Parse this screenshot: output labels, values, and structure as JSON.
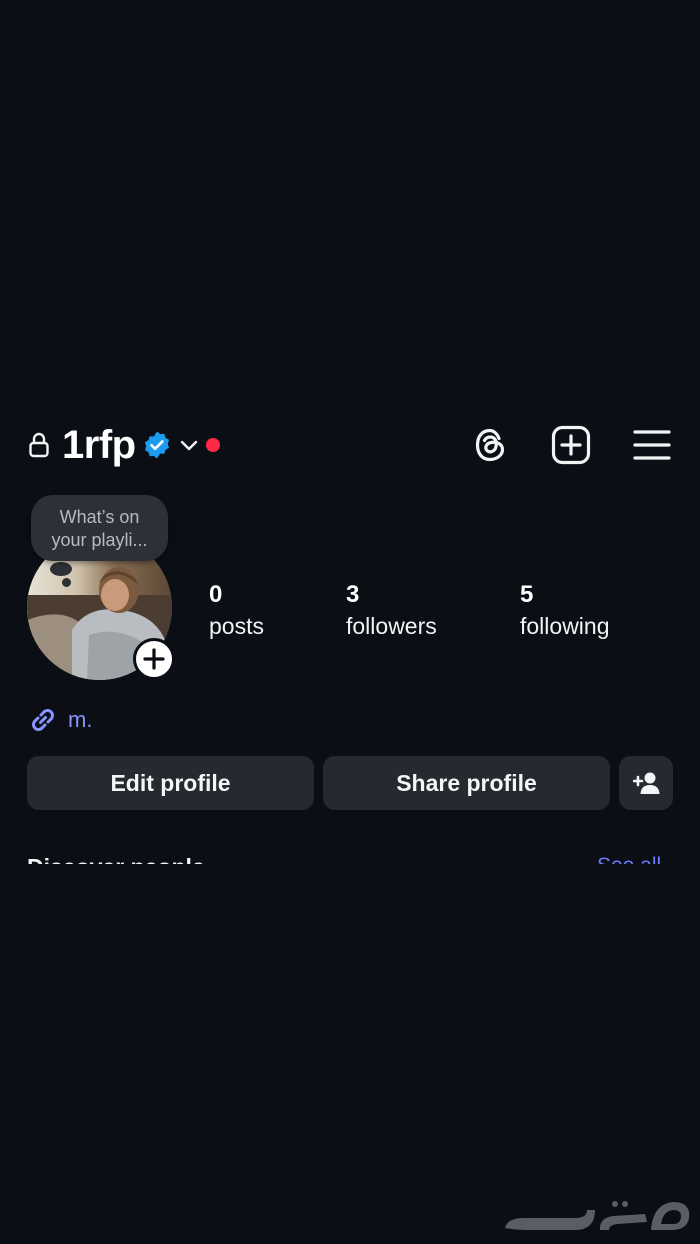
{
  "header": {
    "username": "1rfp",
    "accent_verified": "#1d9bf0",
    "notification_dot_color": "#ff2a45"
  },
  "note": {
    "line1": "What’s on",
    "line2": "your playli..."
  },
  "stats": [
    {
      "count": "0",
      "label": "posts"
    },
    {
      "count": "3",
      "label": "followers"
    },
    {
      "count": "5",
      "label": "following"
    }
  ],
  "bio": {
    "link_text": "m.",
    "link_color": "#8a93ff"
  },
  "actions": {
    "edit_label": "Edit profile",
    "share_label": "Share profile"
  },
  "discover": {
    "title": "Discover people",
    "see_all_label": "See all"
  },
  "icons": [
    "lock-icon",
    "verified-badge-icon",
    "chevron-down-icon",
    "threads-icon",
    "create-post-icon",
    "menu-icon",
    "plus-icon",
    "link-icon",
    "add-person-icon"
  ]
}
